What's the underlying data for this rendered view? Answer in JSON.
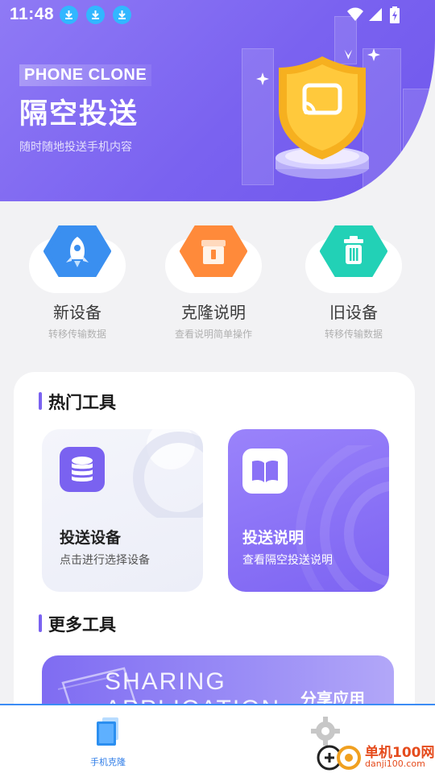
{
  "status_bar": {
    "time": "11:48"
  },
  "hero": {
    "brand_tag": "PHONE CLONE",
    "title": "隔空投送",
    "subtitle": "随时随地投送手机内容"
  },
  "actions": [
    {
      "label": "新设备",
      "sub": "转移传输数据",
      "icon": "rocket-icon",
      "color": "#3a8ff0"
    },
    {
      "label": "克隆说明",
      "sub": "查看说明简单操作",
      "icon": "box-icon",
      "color": "#ff8a3a"
    },
    {
      "label": "旧设备",
      "sub": "转移传输数据",
      "icon": "trash-icon",
      "color": "#22d1b6"
    }
  ],
  "hot_tools": {
    "title": "热门工具",
    "items": [
      {
        "title": "投送设备",
        "sub": "点击进行选择设备",
        "icon": "database-icon"
      },
      {
        "title": "投送说明",
        "sub": "查看隔空投送说明",
        "icon": "book-icon"
      }
    ]
  },
  "more_tools": {
    "title": "更多工具",
    "banner_big_line1": "SHARING",
    "banner_big_line2": "APPLICATION",
    "banner_label": "分享应用"
  },
  "bottom_nav": {
    "items": [
      {
        "label": "手机克隆",
        "icon": "phone-clone-icon",
        "active": true
      },
      {
        "label": "",
        "icon": "gear-icon",
        "active": false
      }
    ]
  },
  "watermark": {
    "name": "单机100网",
    "url": "danji100.com"
  },
  "colors": {
    "accent": "#7a62f0",
    "nav_active": "#2f7de8",
    "download_badge": "#32b7ff"
  }
}
